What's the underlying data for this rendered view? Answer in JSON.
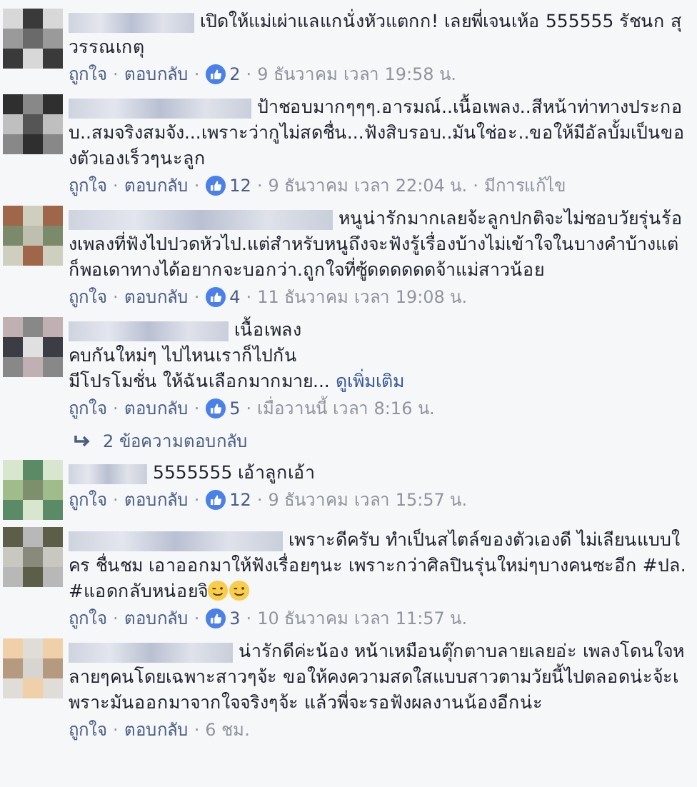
{
  "separator": "·",
  "comments": [
    {
      "text": "เปิดให้แม่เผ่าแลแกนั่งหัวแตกก! เลยพี่เจนเห้อ 555555 รัชนก สุวรรณเกตุ",
      "like": "ถูกใจ",
      "reply": "ตอบกลับ",
      "reactions": "2",
      "time": "9 ธันวาคม เวลา 19:58 น."
    },
    {
      "text": "ป้าชอบมากๆๆๆ.อารมณ์..เนื้อเพลง..สีหน้าท่าทางประกอบ..สมจริงสมจัง...เพราะว่ากูไม่สดชื่น...ฟังสิบรอบ..มันใช่อะ..ขอให้มีอัลบั้มเป็นของตัวเองเร็วๆนะลูก",
      "like": "ถูกใจ",
      "reply": "ตอบกลับ",
      "reactions": "12",
      "time": "9 ธันวาคม เวลา 22:04 น.",
      "edited": "มีการแก้ไข"
    },
    {
      "text": "หนูน่ารักมากเลยจ้ะลูกปกติจะไม่ชอบวัยรุ่นร้องเพลงที่ฟังไปปวดหัวไป.แต่สำหรับหนูถึงจะฟังรู้เรื่องบ้างไม่เข้าใจในบางคำบ้างแต่ก็พอเดาทางได้อยากจะบอกว่า.ถูกใจที่ซู้ดดดดดดจ้าแม่สาวน้อย",
      "like": "ถูกใจ",
      "reply": "ตอบกลับ",
      "reactions": "4",
      "time": "11 ธันวาคม เวลา 19:08 น."
    },
    {
      "lines": [
        "เนื้อเพลง",
        "คบกันใหม่ๆ ไปไหนเราก็ไปกัน",
        "มีโปรโมชั่น ให้ฉันเลือกมากมาย..."
      ],
      "see_more": "ดูเพิ่มเติม",
      "like": "ถูกใจ",
      "reply": "ตอบกลับ",
      "reactions": "5",
      "time": "เมื่อวานนี้ เวลา 8:16 น.",
      "replies": "2 ข้อความตอบกลับ"
    },
    {
      "text": "5555555 เอ้าลูกเอ้า",
      "like": "ถูกใจ",
      "reply": "ตอบกลับ",
      "reactions": "12",
      "time": "9 ธันวาคม เวลา 15:57 น."
    },
    {
      "text": "เพราะดีครับ ทำเป็นสไตล์ของตัวเองดี ไม่เลียนแบบใคร ชื่นชม เอาออกมาให้ฟังเรื่อยๆนะ เพราะกว่าศิลปินรุ่นใหม่ๆบางคนซะอีก #ปล. #แอดกลับหน่อยจิ",
      "trailing_icons": [
        {
          "kind": "emoji"
        },
        {
          "kind": "emoji"
        }
      ],
      "like": "ถูกใจ",
      "reply": "ตอบกลับ",
      "reactions": "3",
      "time": "10 ธันวาคม เวลา 11:57 น."
    },
    {
      "text": "น่ารักดีค่ะน้อง หน้าเหมือนตุ๊กตาบลายเลยอ่ะ เพลงโดนใจหลายๆคนโดยเฉพาะสาวๆจ้ะ ขอให้คงความสดใสแบบสาวตามวัยนี้ไปตลอดน่ะจ้ะเพราะมันออกมาจากใจจริงๆจ้ะ แล้วพี่จะรอฟังผลงานน้องอีกน่ะ",
      "like": "ถูกใจ",
      "reply": "ตอบกลับ",
      "time": "6 ชม."
    }
  ]
}
